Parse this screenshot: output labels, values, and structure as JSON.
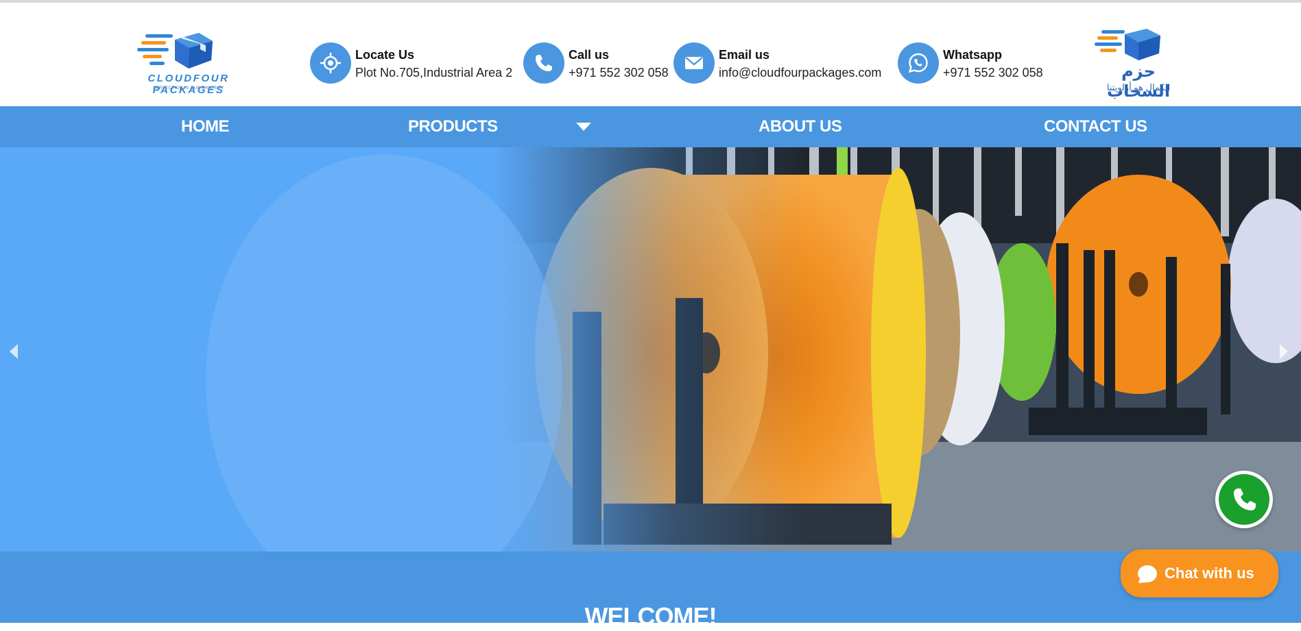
{
  "header": {
    "logo_left": {
      "brand": "CLOUDFOUR PACKAGES",
      "tagline": "PERFECTION IS OUR PRIORITY"
    },
    "logo_right": {
      "arabic_name": "حزم السحاب",
      "arabic_tagline": "الكمال هو أولويتنا"
    },
    "contacts": [
      {
        "title": "Locate Us",
        "value": "Plot No.705,Industrial Area 2",
        "icon": "location-target-icon"
      },
      {
        "title": "Call us",
        "value": "+971 552 302 058",
        "icon": "phone-icon"
      },
      {
        "title": "Email us",
        "value": "info@cloudfourpackages.com",
        "icon": "envelope-icon"
      },
      {
        "title": "Whatsapp",
        "value": "+971 552 302 058",
        "icon": "whatsapp-icon"
      }
    ]
  },
  "nav": {
    "items": [
      {
        "label": "HOME"
      },
      {
        "label": "PRODUCTS"
      },
      {
        "label": "ABOUT US"
      },
      {
        "label": "CONTACT US"
      }
    ]
  },
  "hero": {
    "prev_icon": "chevron-left-icon",
    "next_icon": "chevron-right-icon"
  },
  "welcome": {
    "heading": "WELCOME!"
  },
  "chat": {
    "label": "Chat with us",
    "icon": "chat-bubble-icon"
  },
  "colors": {
    "accent": "#4a96e0",
    "chat_button": "#f7931e",
    "whatsapp": "#1aa02c"
  }
}
